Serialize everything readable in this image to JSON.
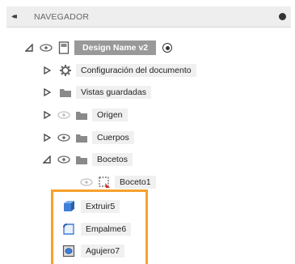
{
  "header": {
    "title": "NAVEGADOR",
    "collapse_glyph": "◂◂"
  },
  "root": {
    "label": "Design Name v2"
  },
  "items": [
    {
      "label": "Configuración del documento",
      "icon": "gear-icon"
    },
    {
      "label": "Vistas guardadas",
      "icon": "folder-icon"
    },
    {
      "label": "Origen",
      "icon": "folder-icon"
    },
    {
      "label": "Cuerpos",
      "icon": "folder-icon"
    },
    {
      "label": "Bocetos",
      "icon": "folder-icon"
    }
  ],
  "sketch": {
    "label": "Boceto1"
  },
  "timeline": [
    {
      "label": "Extruir5",
      "icon": "extrude-icon"
    },
    {
      "label": "Empalme6",
      "icon": "fillet-icon"
    },
    {
      "label": "Agujero7",
      "icon": "hole-icon"
    }
  ],
  "colors": {
    "highlight": "#f7a12b",
    "root_label_bg": "#999999",
    "header_bg": "#eeeeee"
  }
}
